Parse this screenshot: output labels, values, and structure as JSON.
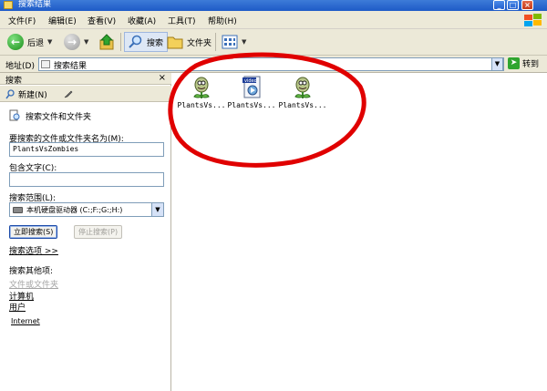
{
  "window": {
    "title": "搜索结果",
    "buttons": [
      "_",
      "□",
      "×"
    ]
  },
  "menu": [
    "文件(F)",
    "编辑(E)",
    "查看(V)",
    "收藏(A)",
    "工具(T)",
    "帮助(H)"
  ],
  "toolbar": {
    "back_label": "后退",
    "search_label": "搜索",
    "folders_label": "文件夹"
  },
  "address": {
    "label": "地址(D)",
    "value": "搜索结果",
    "go_label": "转到"
  },
  "pane": {
    "title": "搜索",
    "close": "×",
    "new_label": "新建(N)",
    "heading": "搜索文件和文件夹",
    "name_label": "要搜索的文件或文件夹名为(M):",
    "name_value": "PlantsVsZombies",
    "contains_label": "包含文字(C):",
    "contains_value": "",
    "scope_label": "搜索范围(L):",
    "scope_value": "本机硬盘驱动器 (C:;F:;G:;H:)",
    "search_now": "立即搜索(S)",
    "stop_search": "停止搜索(P)",
    "options": "搜索选项 >>",
    "other_label": "搜索其他项:",
    "other_items": [
      "文件或文件夹",
      "计算机",
      "用户",
      "Internet"
    ]
  },
  "files": [
    {
      "name": "PlantsVs...",
      "icon": "plant-icon"
    },
    {
      "name": "PlantsVs...",
      "icon": "video-file-icon",
      "badge": "video"
    },
    {
      "name": "PlantsVs...",
      "icon": "plant-icon"
    }
  ],
  "colors": {
    "title_blue": "#1e5ac7",
    "chrome": "#ece9d8",
    "annotation": "#e00000"
  }
}
